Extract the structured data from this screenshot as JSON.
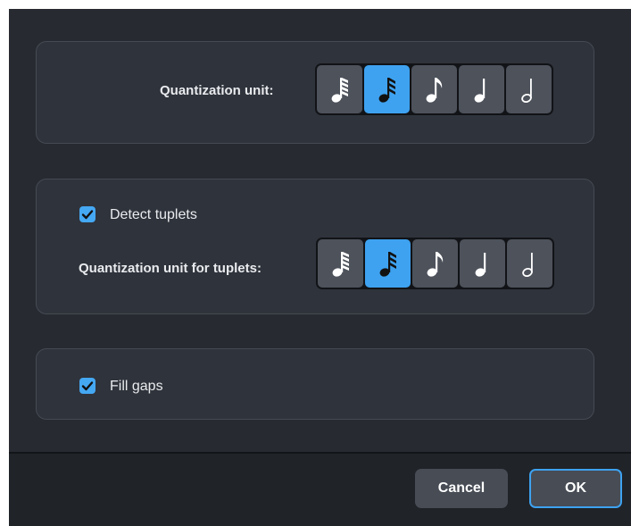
{
  "quantization": {
    "label": "Quantization unit:",
    "options": [
      {
        "icon": "sixty-fourth-note-icon",
        "selected": false
      },
      {
        "icon": "thirty-second-note-icon",
        "selected": true
      },
      {
        "icon": "sixteenth-note-icon",
        "selected": false
      },
      {
        "icon": "quarter-note-icon",
        "selected": false
      },
      {
        "icon": "half-note-icon",
        "selected": false
      }
    ]
  },
  "tuplets": {
    "detect_label": "Detect tuplets",
    "detect_checked": true,
    "unit_label": "Quantization unit for tuplets:",
    "options": [
      {
        "icon": "sixty-fourth-note-icon",
        "selected": false
      },
      {
        "icon": "thirty-second-note-icon",
        "selected": true
      },
      {
        "icon": "sixteenth-note-icon",
        "selected": false
      },
      {
        "icon": "quarter-note-icon",
        "selected": false
      },
      {
        "icon": "half-note-icon",
        "selected": false
      }
    ]
  },
  "fill_gaps": {
    "label": "Fill gaps",
    "checked": true
  },
  "footer": {
    "cancel_label": "Cancel",
    "ok_label": "OK"
  },
  "colors": {
    "accent": "#3ea2f0",
    "dialog_bg": "#272a31",
    "panel_bg": "#2f333b"
  }
}
